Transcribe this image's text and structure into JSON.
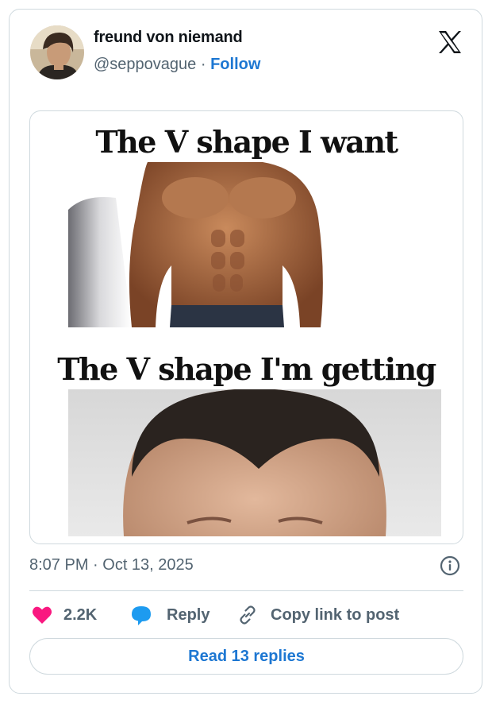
{
  "tweet": {
    "author": {
      "display_name": "freund von niemand",
      "handle": "@seppovague",
      "separator": " · ",
      "follow_label": "Follow"
    },
    "logo_icon": "x-logo-icon",
    "media": {
      "caption_top": "The V shape I want",
      "caption_bottom": "The V shape  I'm getting"
    },
    "timestamp": "8:07 PM · Oct 13, 2025",
    "info_icon": "info-icon",
    "actions": {
      "like_count": "2.2K",
      "reply_label": "Reply",
      "copy_label": "Copy link to post"
    },
    "read_replies_label": "Read 13 replies"
  },
  "colors": {
    "link_blue": "#1d77d2",
    "like_pink": "#f91880",
    "reply_blue": "#1d9bf0",
    "muted_text": "#536471",
    "border": "#cfd9de"
  }
}
